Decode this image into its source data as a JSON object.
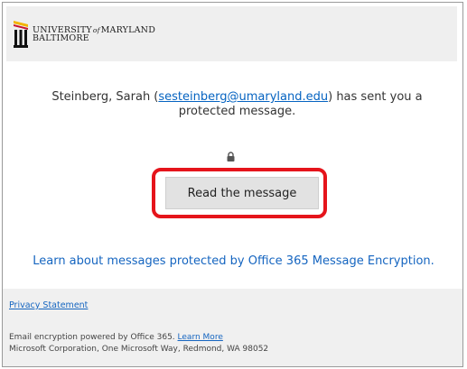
{
  "header": {
    "logo": {
      "line1_a": "UNIVERSITY",
      "line1_of": "of",
      "line1_b": "MARYLAND",
      "line2": "BALTIMORE"
    }
  },
  "message": {
    "sender_name": "Steinberg, Sarah (",
    "sender_email": "sesteinberg@umaryland.edu",
    "sender_suffix": ") has sent you a protected message.",
    "read_button_label": "Read the message",
    "learn_link": "Learn about messages protected by Office 365 Message Encryption."
  },
  "footer": {
    "privacy_link": "Privacy Statement",
    "powered_text": "Email encryption powered by Office 365. ",
    "learn_more_link": "Learn More",
    "address": "Microsoft Corporation, One Microsoft Way, Redmond, WA 98052"
  },
  "colors": {
    "link_blue": "#1565c0",
    "email_link": "#0563c1",
    "highlight_red": "#e5141b",
    "button_gray": "#e2e2e2",
    "band_gray": "#efefef"
  },
  "icons": [
    "university-logo-icon",
    "lock-icon"
  ]
}
